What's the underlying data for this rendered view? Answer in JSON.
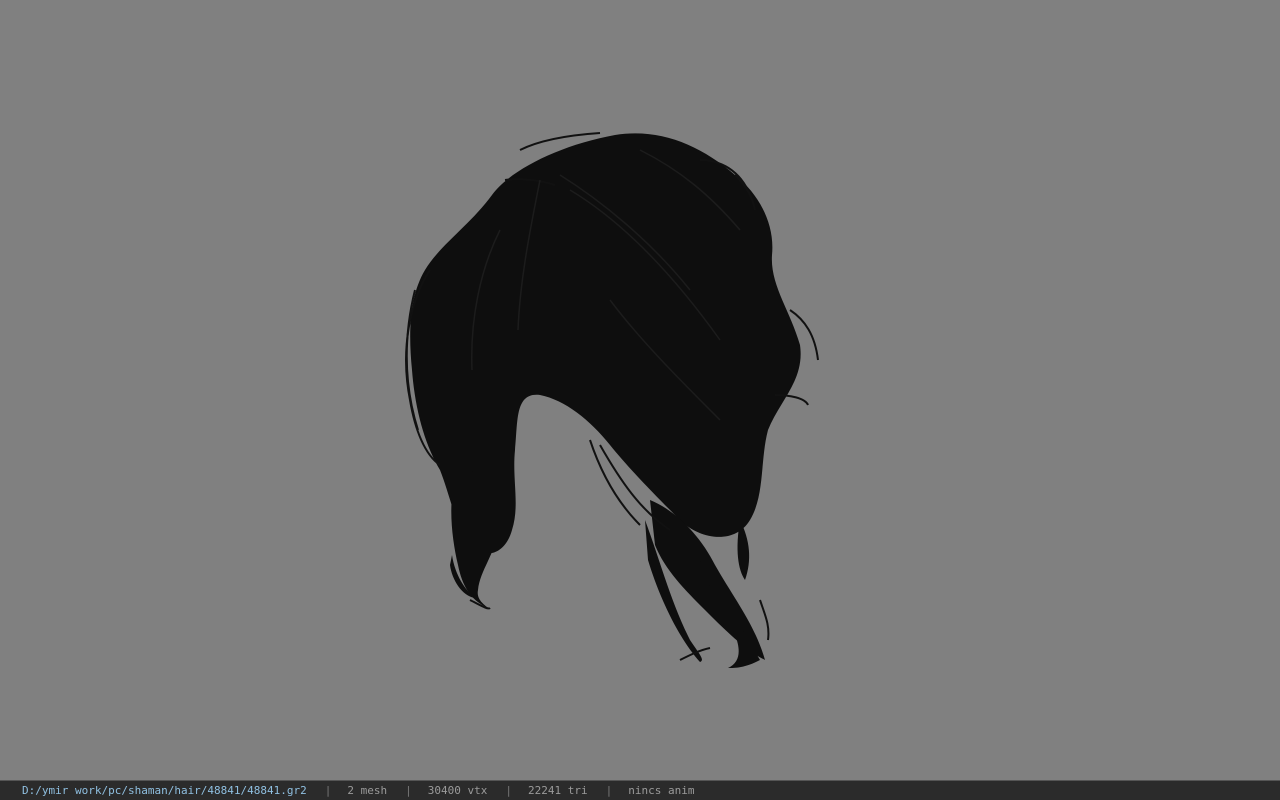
{
  "viewer": {
    "background_color": "#808080",
    "model_color": "#0d0d0d"
  },
  "status": {
    "path": "D:/ymir work/pc/shaman/hair/48841/48841.gr2",
    "separator": "|",
    "mesh": "2 mesh",
    "vtx": "30400 vtx",
    "tri": "22241 tri",
    "anim": "nincs anim"
  }
}
